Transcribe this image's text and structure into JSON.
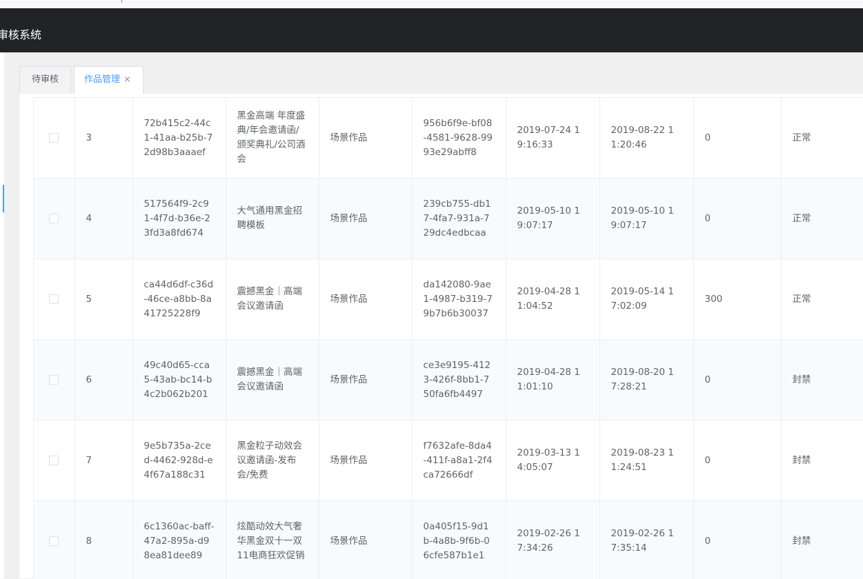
{
  "app": {
    "title": "审核系统"
  },
  "tabs": [
    {
      "label": "待审核",
      "close": ""
    },
    {
      "label": "作品管理",
      "close": "×"
    }
  ],
  "table": {
    "rows": [
      {
        "index": "3",
        "id": "72b415c2-44c1-41aa-b25b-72d98b3aaaef",
        "name": "黑金高端 年度盛典/年会邀请函/颁奖典礼/公司酒会",
        "type": "场景作品",
        "uid": "956b6f9e-bf08-4581-9628-9993e29abff8",
        "created": "2019-07-24 19:16:33",
        "updated": "2019-08-22 11:20:46",
        "count": "0",
        "status": "正常"
      },
      {
        "index": "4",
        "id": "517564f9-2c91-4f7d-b36e-23fd3a8fd674",
        "name": "大气通用黑金招聘模板",
        "type": "场景作品",
        "uid": "239cb755-db17-4fa7-931a-729dc4edbcaa",
        "created": "2019-05-10 19:07:17",
        "updated": "2019-05-10 19:07:17",
        "count": "0",
        "status": "正常"
      },
      {
        "index": "5",
        "id": "ca44d6df-c36d-46ce-a8bb-8a41725228f9",
        "name": "震撼黑金｜高端会议邀请函",
        "type": "场景作品",
        "uid": "da142080-9ae1-4987-b319-79b7b6b30037",
        "created": "2019-04-28 11:04:52",
        "updated": "2019-05-14 17:02:09",
        "count": "300",
        "status": "正常"
      },
      {
        "index": "6",
        "id": "49c40d65-cca5-43ab-bc14-b4c2b062b201",
        "name": "震撼黑金｜高端会议邀请函",
        "type": "场景作品",
        "uid": "ce3e9195-4123-426f-8bb1-750fa6fb4497",
        "created": "2019-04-28 11:01:10",
        "updated": "2019-08-20 17:28:21",
        "count": "0",
        "status": "封禁"
      },
      {
        "index": "7",
        "id": "9e5b735a-2ced-4462-928d-e4f67a188c31",
        "name": "黑金粒子动效会议邀请函-发布会/免费",
        "type": "场景作品",
        "uid": "f7632afe-8da4-411f-a8a1-2f4ca72666df",
        "created": "2019-03-13 14:05:07",
        "updated": "2019-08-23 11:24:51",
        "count": "0",
        "status": "封禁"
      },
      {
        "index": "8",
        "id": "6c1360ac-baff-47a2-895a-d98ea81dee89",
        "name": "炫酷动效大气奢华黑金双十一双11电商狂欢促销",
        "type": "场景作品",
        "uid": "0a405f15-9d1b-4a8b-9f6b-06cfe587b1e1",
        "created": "2019-02-26 17:34:26",
        "updated": "2019-02-26 17:35:14",
        "count": "0",
        "status": "封禁"
      }
    ]
  }
}
